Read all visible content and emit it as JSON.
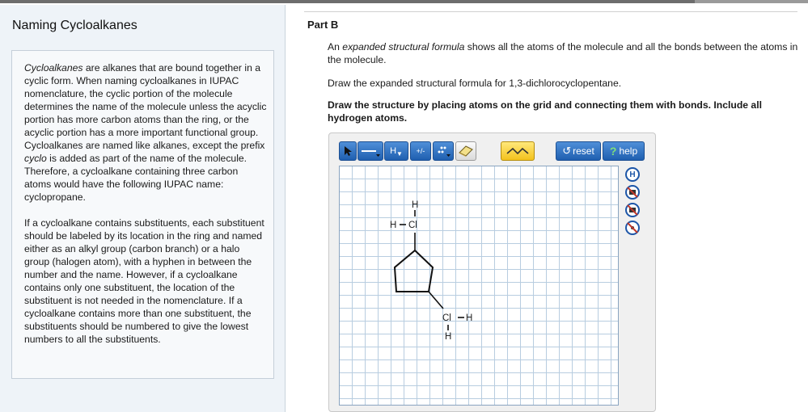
{
  "left": {
    "title": "Naming Cycloalkanes",
    "info": {
      "p1_term": "Cycloalkanes",
      "p1_text": " are alkanes that are bound together in a cyclic form. When naming cycloalkanes in IUPAC nomenclature, the cyclic portion of the molecule determines the name of the molecule unless the acyclic portion has more carbon atoms than the ring, or the acyclic portion has a more important functional group. Cycloalkanes are named like alkanes, except the prefix ",
      "p1_prefix": "cyclo",
      "p1_end": " is added as part of the name of the molecule. Therefore, a cycloalkane containing three carbon atoms would have the following IUPAC name: cyclopropane.",
      "p2": "If a cycloalkane contains substituents, each substituent should be labeled by its location in the ring and named either as an alkyl group (carbon branch) or a halo group (halogen atom), with a hyphen in between the number and the name. However, if a cycloalkane contains only one substituent, the location of the substituent is not needed in the nomenclature. If a cycloalkane contains more than one substituent, the substituents should be numbered to give the lowest numbers to all the substituents."
    }
  },
  "main": {
    "part_title": "Part B",
    "p1_pre": "An ",
    "p1_term": "expanded structural formula",
    "p1_post": " shows all the atoms of the molecule and all the bonds between the atoms in the molecule.",
    "p2": "Draw the expanded structural formula for 1,3-dichlorocyclopentane.",
    "p3": "Draw the structure by placing atoms on the grid and connecting them with bonds. Include all hydrogen atoms."
  },
  "toolbar": {
    "h_label": "H",
    "charge_label": "+/-",
    "reset_label": "reset",
    "help_label": "help",
    "reset_glyph": "↺",
    "help_glyph": "?"
  },
  "side_tools": {
    "h_label": "H"
  },
  "molecule": {
    "atoms": {
      "h1": "H",
      "h2": "H",
      "cl1": "Cl",
      "cl2": "Cl",
      "h3": "H",
      "h4": "H"
    }
  },
  "colors": {
    "accent": "#1d56a8",
    "panel_bg": "#eef3f8",
    "grid": "#b8cde0"
  }
}
